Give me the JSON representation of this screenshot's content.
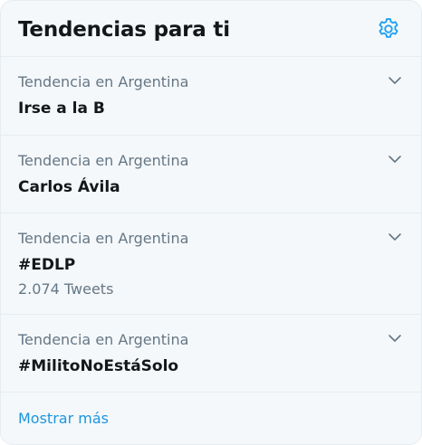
{
  "header": {
    "title": "Tendencias para ti",
    "settings_icon": "gear-icon"
  },
  "trends": [
    {
      "context": "Tendencia en Argentina",
      "name": "Irse a la B"
    },
    {
      "context": "Tendencia en Argentina",
      "name": "Carlos Ávila"
    },
    {
      "context": "Tendencia en Argentina",
      "name": "#EDLP",
      "count": "2.074 Tweets"
    },
    {
      "context": "Tendencia en Argentina",
      "name": "#MilitoNoEstáSolo"
    }
  ],
  "footer": {
    "more_label": "Mostrar más"
  },
  "colors": {
    "accent": "#1b95e0",
    "background": "#f5f8fa",
    "border": "#e6ecf0",
    "text_primary": "#14171a",
    "text_secondary": "#657786"
  }
}
